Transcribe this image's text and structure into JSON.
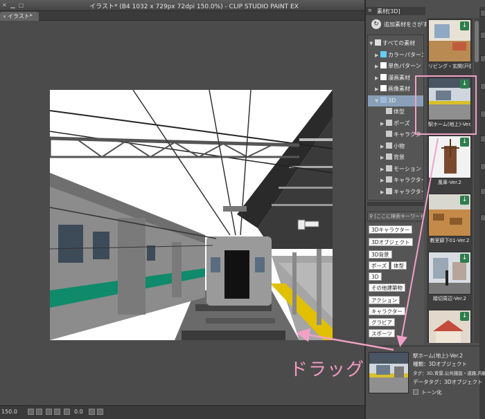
{
  "window": {
    "title": "イラスト* (B4 1032 x 729px 72dpi 150.0%) - CLIP STUDIO PAINT EX",
    "tab_label": "イラスト*"
  },
  "statusbar": {
    "zoom": "150.0",
    "rotation": "0.0"
  },
  "material_panel": {
    "header_label": "素材[3D]",
    "search_label": "追加素材をさがす",
    "tree": [
      {
        "label": "すべての素材",
        "arrow": "▼",
        "indent": 0
      },
      {
        "label": "カラーパターン",
        "arrow": "▶",
        "indent": 1
      },
      {
        "label": "単色パターン",
        "arrow": "▶",
        "indent": 1
      },
      {
        "label": "漫画素材",
        "arrow": "▶",
        "indent": 1
      },
      {
        "label": "画像素材",
        "arrow": "▶",
        "indent": 1
      },
      {
        "label": "3D",
        "arrow": "▼",
        "indent": 1
      },
      {
        "label": "体型",
        "arrow": "",
        "indent": 2
      },
      {
        "label": "ポーズ",
        "arrow": "▶",
        "indent": 2
      },
      {
        "label": "キャラクター",
        "arrow": "",
        "indent": 2
      },
      {
        "label": "小物",
        "arrow": "▶",
        "indent": 2
      },
      {
        "label": "背景",
        "arrow": "▶",
        "indent": 2
      },
      {
        "label": "モーション",
        "arrow": "▶",
        "indent": 2
      },
      {
        "label": "キャラクター",
        "arrow": "▶",
        "indent": 2
      },
      {
        "label": "キャラクター",
        "arrow": "▶",
        "indent": 2
      }
    ],
    "keyword_placeholder": "[ここに検索キーワードを入",
    "tags": [
      "3Dキャラクター",
      "3Dオブジェクト",
      "3D背景",
      "ポーズ",
      "体型",
      "3D",
      "その他建築物",
      "アクション",
      "キャラクター",
      "グラビア",
      "スポーツ"
    ],
    "thumbnails": [
      {
        "caption": "リビング・玄関(戸建)-V"
      },
      {
        "caption": "駅ホーム(地上)-Ver.2"
      },
      {
        "caption": "風車-Ver.2"
      },
      {
        "caption": "教室廊下01-Ver.2"
      },
      {
        "caption": "踏切周辺-Ver.2"
      },
      {
        "caption": ""
      }
    ],
    "detail": {
      "name": "駅ホーム(地上)-Ver.2",
      "type": "種類：3Dオブジェクト",
      "tags": "タグ：3D,背景,公共施設・道路,内観,",
      "data_tag": "データタグ：3Dオブジェクト",
      "tone": "トーン化"
    }
  },
  "annotation": {
    "drag_label": "ドラッグ",
    "color": "#f2a1c6"
  }
}
